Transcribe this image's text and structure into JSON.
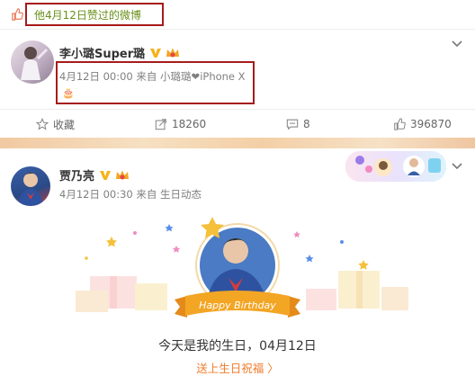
{
  "liked_bar": {
    "text": "他4月12日赞过的微博"
  },
  "post1": {
    "author": "李小璐Super璐",
    "meta": "4月12日 00:00 来自 小璐璐❤iPhone X",
    "content": "🎂"
  },
  "actions": {
    "favorite": "收藏",
    "repost": "18260",
    "comment": "8",
    "like": "396870"
  },
  "post2": {
    "author": "贾乃亮",
    "meta": "4月12日 00:30 来自 生日动态",
    "ribbon": "Happy Birthday",
    "birthday_text": "今天是我的生日，04月12日",
    "birthday_link": "送上生日祝福 〉"
  },
  "colors": {
    "liked_green": "#6a8f1a",
    "link_orange": "#f07c2c",
    "highlight_red": "#a61b1b",
    "ribbon_orange": "#f3a524"
  }
}
